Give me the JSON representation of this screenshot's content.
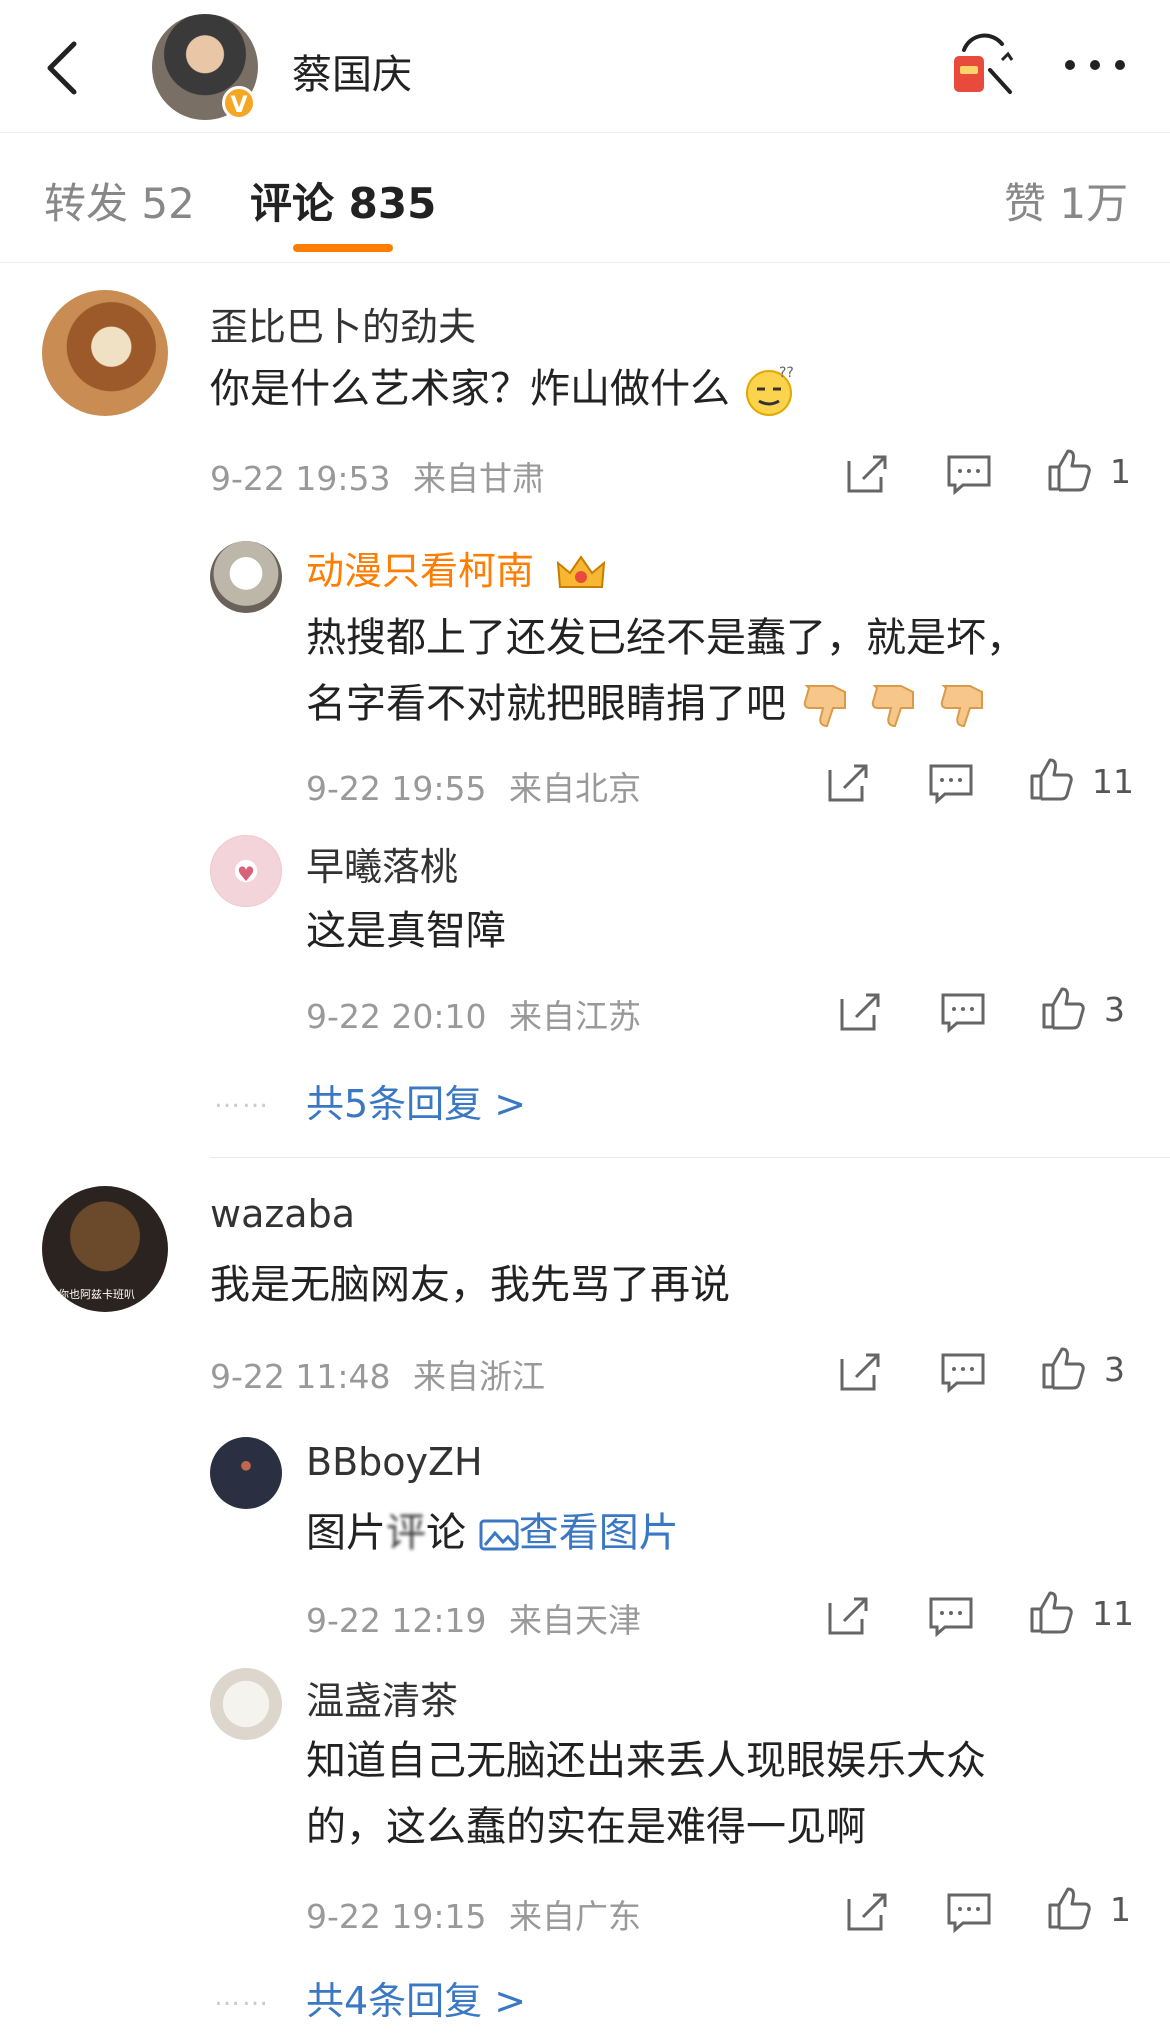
{
  "header": {
    "user_name": "蔡国庆",
    "verified_badge": "V"
  },
  "tabs": [
    {
      "label": "转发 52"
    },
    {
      "label": "评论 835"
    },
    {
      "label": "赞 1万"
    }
  ],
  "comments": [
    {
      "user": "歪比巴卜的劲夫",
      "text": "你是什么艺术家？炸山做什么",
      "emoji": "thinking-face",
      "time": "9-22 19:53",
      "location": "来自甘肃",
      "likes": "1",
      "replies": [
        {
          "user": "动漫只看柯南",
          "badge": "crown-icon",
          "text_line1": "热搜都上了还发已经不是蠢了，就是坏，",
          "text_line2": "名字看不对就把眼睛捐了吧",
          "emoji": "thumbs-down",
          "time": "9-22 19:55",
          "location": "来自北京",
          "likes": "11"
        },
        {
          "user": "早曦落桃",
          "text": "这是真智障",
          "time": "9-22 20:10",
          "location": "来自江苏",
          "likes": "3"
        }
      ],
      "more_replies": "共5条回复 >"
    },
    {
      "user": "wazaba",
      "avatar_caption": "你也阿兹卡班叭",
      "text": "我是无脑网友，我先骂了再说",
      "time": "9-22 11:48",
      "location": "来自浙江",
      "likes": "3",
      "replies": [
        {
          "user": "BBboyZH",
          "text_prefix": "图片",
          "text_blurred": "评",
          "text_suffix": "论",
          "link": "查看图片",
          "time": "9-22 12:19",
          "location": "来自天津",
          "likes": "11"
        },
        {
          "user": "温盏清茶",
          "text_line1": "知道自己无脑还出来丢人现眼娱乐大众",
          "text_line2": "的，这么蠢的实在是难得一见啊",
          "time": "9-22 19:15",
          "location": "来自广东",
          "likes": "1"
        }
      ],
      "more_replies": "共4条回复 >"
    }
  ],
  "colors": {
    "accent": "#ff7d00",
    "link": "#3a78c3",
    "meta": "#999999"
  }
}
